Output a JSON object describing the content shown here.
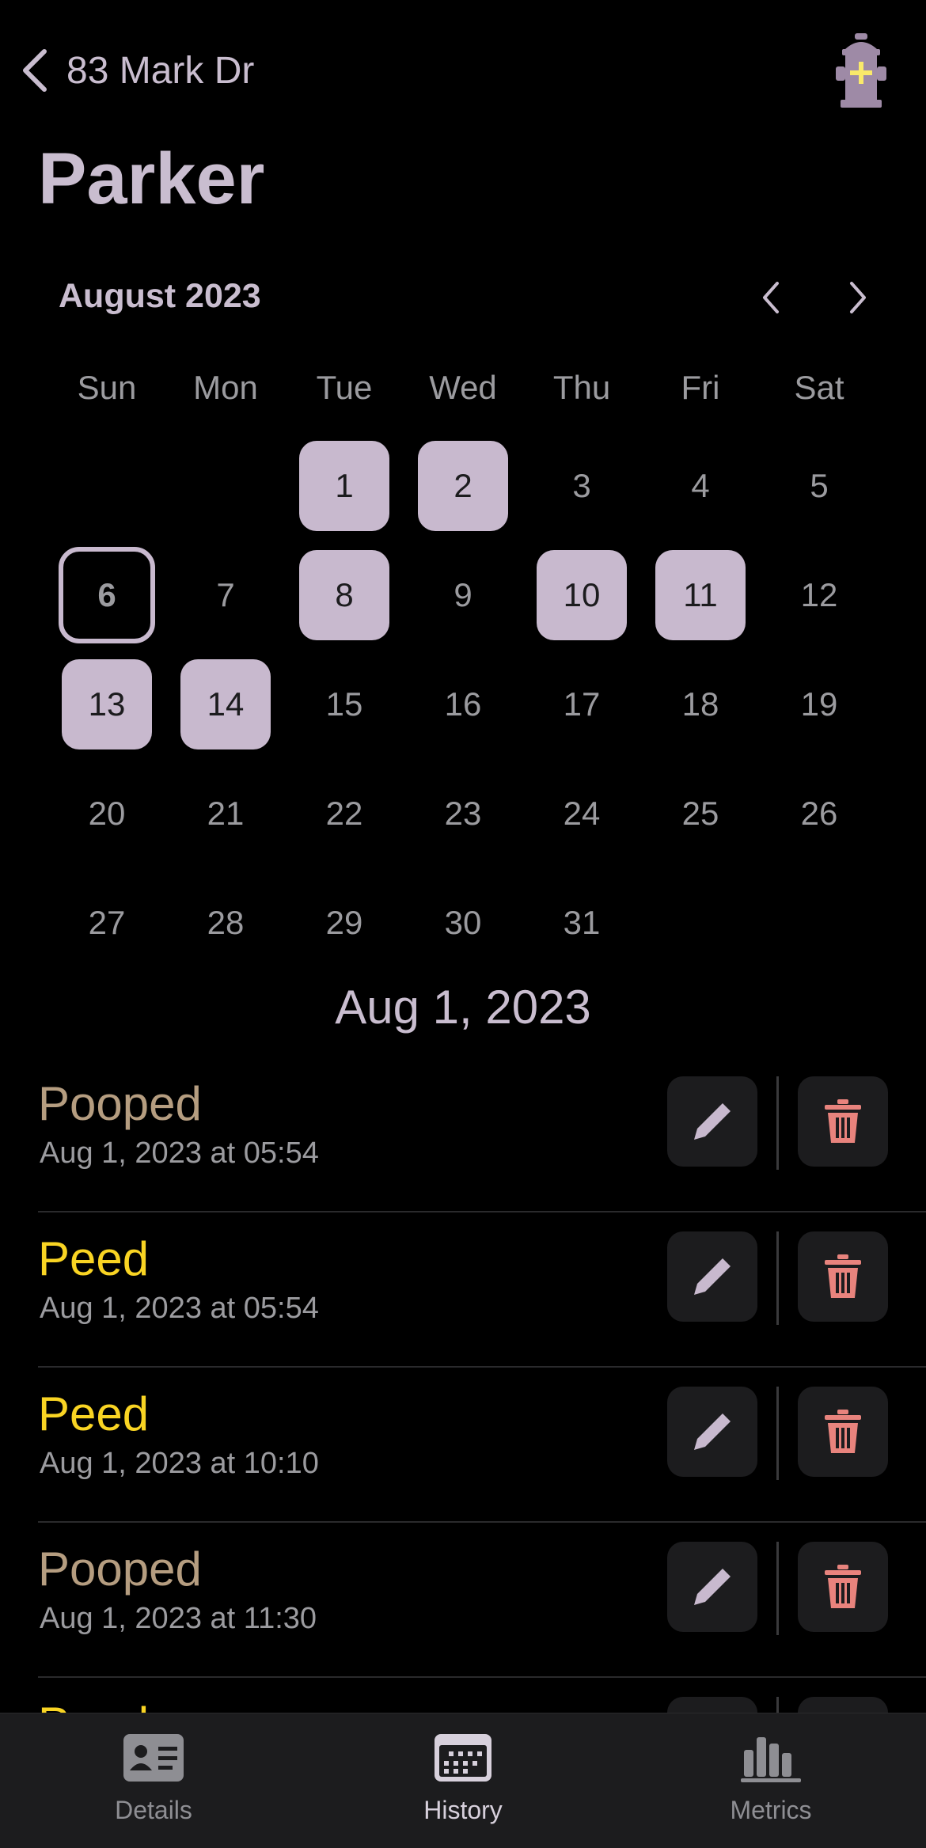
{
  "nav": {
    "back_label": "83 Mark Dr"
  },
  "title": "Parker",
  "calendar": {
    "month_label": "August 2023",
    "weekdays": [
      "Sun",
      "Mon",
      "Tue",
      "Wed",
      "Thu",
      "Fri",
      "Sat"
    ],
    "days": [
      "1",
      "2",
      "3",
      "4",
      "5",
      "6",
      "7",
      "8",
      "9",
      "10",
      "11",
      "12",
      "13",
      "14",
      "15",
      "16",
      "17",
      "18",
      "19",
      "20",
      "21",
      "22",
      "23",
      "24",
      "25",
      "26",
      "27",
      "28",
      "29",
      "30",
      "31"
    ],
    "logged_days": [
      1,
      2,
      8,
      10,
      11,
      13,
      14
    ],
    "today": 6
  },
  "selected_date": "Aug 1, 2023",
  "entries": [
    {
      "title": "Pooped",
      "type": "pooped",
      "time": "Aug 1, 2023 at 05:54"
    },
    {
      "title": "Peed",
      "type": "peed",
      "time": "Aug 1, 2023 at 05:54"
    },
    {
      "title": "Peed",
      "type": "peed",
      "time": "Aug 1, 2023 at 10:10"
    },
    {
      "title": "Pooped",
      "type": "pooped",
      "time": "Aug 1, 2023 at 11:30"
    },
    {
      "title": "Peed",
      "type": "peed",
      "time": ""
    }
  ],
  "tabs": [
    {
      "label": "Details",
      "icon": "id-card-icon",
      "active": false
    },
    {
      "label": "History",
      "icon": "calendar-icon",
      "active": true
    },
    {
      "label": "Metrics",
      "icon": "bar-chart-icon",
      "active": false
    }
  ],
  "colors": {
    "accent": "#c8b9ce",
    "pooped": "#b59d80",
    "peed": "#f9d423",
    "delete": "#e8837d",
    "background": "#000000"
  }
}
